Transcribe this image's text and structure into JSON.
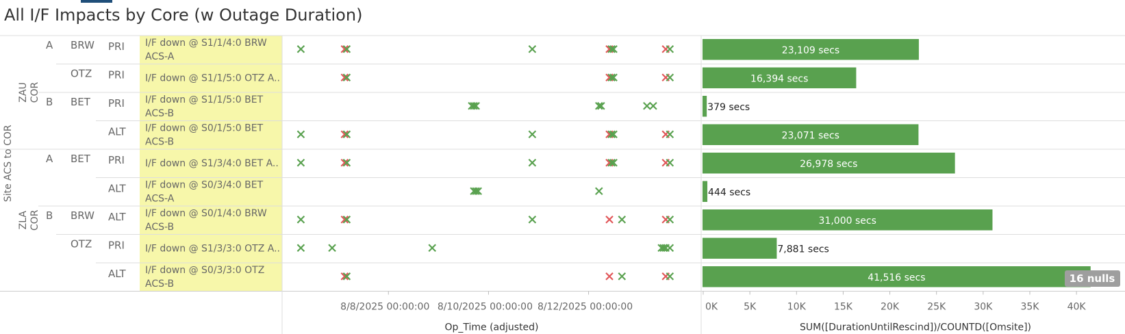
{
  "title": "All I/F Impacts by Core (w Outage Duration)",
  "chart_data": {
    "type": "bar",
    "title": "All I/F Impacts by Core (w Outage Duration)",
    "dimension_labels": {
      "outer": "Site ACS to COR"
    },
    "groups": [
      {
        "core": "ZAU COR",
        "row_start": 0,
        "row_end": 4
      },
      {
        "core": "ZLA COR",
        "row_start": 4,
        "row_end": 9
      }
    ],
    "rows": [
      {
        "core": "ZAU COR",
        "acs": "A",
        "site": "BRW",
        "path": "PRI",
        "interface": [
          "I/F down @ S1/1/4:0 BRW",
          "ACS-A"
        ],
        "value": 23109,
        "value_label": "23,109 secs",
        "marks": [
          {
            "x": "2025-08-06 06:00",
            "c": "g"
          },
          {
            "x": "2025-08-07 03:00",
            "c": "r"
          },
          {
            "x": "2025-08-07 04:00",
            "c": "g"
          },
          {
            "x": "2025-08-10 21:00",
            "c": "g"
          },
          {
            "x": "2025-08-12 10:00",
            "c": "r"
          },
          {
            "x": "2025-08-12 11:00",
            "c": "g"
          },
          {
            "x": "2025-08-12 12:00",
            "c": "g"
          },
          {
            "x": "2025-08-13 13:00",
            "c": "r"
          },
          {
            "x": "2025-08-13 15:00",
            "c": "g"
          }
        ]
      },
      {
        "core": "ZAU COR",
        "acs": "",
        "site": "OTZ",
        "path": "PRI",
        "interface": [
          "I/F down @ S1/1/5:0 OTZ A.."
        ],
        "value": 16394,
        "value_label": "16,394 secs",
        "marks": [
          {
            "x": "2025-08-07 03:00",
            "c": "r"
          },
          {
            "x": "2025-08-07 04:00",
            "c": "g"
          },
          {
            "x": "2025-08-12 10:00",
            "c": "r"
          },
          {
            "x": "2025-08-12 11:00",
            "c": "g"
          },
          {
            "x": "2025-08-12 12:00",
            "c": "g"
          },
          {
            "x": "2025-08-13 13:00",
            "c": "r"
          },
          {
            "x": "2025-08-13 15:00",
            "c": "g"
          }
        ]
      },
      {
        "core": "ZAU COR",
        "acs": "B",
        "site": "BET",
        "path": "PRI",
        "interface": [
          "I/F down @ S1/1/5:0 BET",
          "ACS-B"
        ],
        "value": 379,
        "value_label": "379 secs",
        "marks": [
          {
            "x": "2025-08-09 16:00",
            "c": "g"
          },
          {
            "x": "2025-08-09 17:00",
            "c": "g"
          },
          {
            "x": "2025-08-09 18:00",
            "c": "g"
          },
          {
            "x": "2025-08-12 05:00",
            "c": "g"
          },
          {
            "x": "2025-08-12 06:00",
            "c": "g"
          },
          {
            "x": "2025-08-13 04:00",
            "c": "g"
          },
          {
            "x": "2025-08-13 07:00",
            "c": "g"
          }
        ]
      },
      {
        "core": "ZAU COR",
        "acs": "",
        "site": "",
        "path": "ALT",
        "interface": [
          "I/F down @ S0/1/5:0 BET",
          "ACS-B"
        ],
        "value": 23071,
        "value_label": "23,071 secs",
        "marks": [
          {
            "x": "2025-08-06 06:00",
            "c": "g"
          },
          {
            "x": "2025-08-07 03:00",
            "c": "r"
          },
          {
            "x": "2025-08-07 04:00",
            "c": "g"
          },
          {
            "x": "2025-08-10 21:00",
            "c": "g"
          },
          {
            "x": "2025-08-12 10:00",
            "c": "r"
          },
          {
            "x": "2025-08-12 11:00",
            "c": "g"
          },
          {
            "x": "2025-08-12 12:00",
            "c": "g"
          },
          {
            "x": "2025-08-13 13:00",
            "c": "r"
          },
          {
            "x": "2025-08-13 15:00",
            "c": "g"
          }
        ]
      },
      {
        "core": "ZLA COR",
        "acs": "A",
        "site": "BET",
        "path": "PRI",
        "interface": [
          "I/F down @ S1/3/4:0 BET A.."
        ],
        "value": 26978,
        "value_label": "26,978 secs",
        "marks": [
          {
            "x": "2025-08-06 06:00",
            "c": "g"
          },
          {
            "x": "2025-08-07 03:00",
            "c": "r"
          },
          {
            "x": "2025-08-07 04:00",
            "c": "g"
          },
          {
            "x": "2025-08-10 21:00",
            "c": "g"
          },
          {
            "x": "2025-08-12 10:00",
            "c": "r"
          },
          {
            "x": "2025-08-12 11:00",
            "c": "g"
          },
          {
            "x": "2025-08-12 12:00",
            "c": "g"
          },
          {
            "x": "2025-08-13 13:00",
            "c": "r"
          },
          {
            "x": "2025-08-13 15:00",
            "c": "g"
          }
        ]
      },
      {
        "core": "ZLA COR",
        "acs": "",
        "site": "",
        "path": "ALT",
        "interface": [
          "I/F down @ S0/3/4:0 BET",
          "ACS-A"
        ],
        "value": 444,
        "value_label": "444 secs",
        "marks": [
          {
            "x": "2025-08-09 17:00",
            "c": "g"
          },
          {
            "x": "2025-08-09 18:00",
            "c": "g"
          },
          {
            "x": "2025-08-09 19:00",
            "c": "g"
          },
          {
            "x": "2025-08-12 05:00",
            "c": "g"
          }
        ]
      },
      {
        "core": "ZLA COR",
        "acs": "B",
        "site": "BRW",
        "path": "ALT",
        "interface": [
          "I/F down @ S0/1/4:0 BRW",
          "ACS-B"
        ],
        "value": 31000,
        "value_label": "31,000 secs",
        "marks": [
          {
            "x": "2025-08-06 06:00",
            "c": "g"
          },
          {
            "x": "2025-08-07 03:00",
            "c": "r"
          },
          {
            "x": "2025-08-07 04:00",
            "c": "g"
          },
          {
            "x": "2025-08-10 21:00",
            "c": "g"
          },
          {
            "x": "2025-08-12 10:00",
            "c": "r"
          },
          {
            "x": "2025-08-12 16:00",
            "c": "g"
          },
          {
            "x": "2025-08-13 13:00",
            "c": "r"
          },
          {
            "x": "2025-08-13 15:00",
            "c": "g"
          }
        ]
      },
      {
        "core": "ZLA COR",
        "acs": "",
        "site": "OTZ",
        "path": "PRI",
        "interface": [
          "I/F down @ S1/3/3:0 OTZ A.."
        ],
        "value": 7881,
        "value_label": "7,881 secs",
        "marks": [
          {
            "x": "2025-08-06 06:00",
            "c": "g"
          },
          {
            "x": "2025-08-06 21:00",
            "c": "g"
          },
          {
            "x": "2025-08-08 21:00",
            "c": "g"
          },
          {
            "x": "2025-08-13 11:00",
            "c": "g"
          },
          {
            "x": "2025-08-13 12:00",
            "c": "g"
          },
          {
            "x": "2025-08-13 13:00",
            "c": "g"
          },
          {
            "x": "2025-08-13 15:00",
            "c": "g"
          }
        ]
      },
      {
        "core": "ZLA COR",
        "acs": "",
        "site": "",
        "path": "ALT",
        "interface": [
          "I/F down @ S0/3/3:0 OTZ",
          "ACS-B"
        ],
        "value": 41516,
        "value_label": "41,516 secs",
        "marks": [
          {
            "x": "2025-08-07 03:00",
            "c": "r"
          },
          {
            "x": "2025-08-07 04:00",
            "c": "g"
          },
          {
            "x": "2025-08-12 10:00",
            "c": "r"
          },
          {
            "x": "2025-08-12 16:00",
            "c": "g"
          },
          {
            "x": "2025-08-13 13:00",
            "c": "r"
          },
          {
            "x": "2025-08-13 15:00",
            "c": "g"
          }
        ]
      }
    ],
    "scatter_axis": {
      "title": "Op_Time (adjusted)",
      "range": [
        "2025-08-05 21:00",
        "2025-08-14 06:00"
      ],
      "ticks": [
        "8/8/2025 00:00:00",
        "8/10/2025 00:00:00",
        "8/12/2025 00:00:00"
      ]
    },
    "bar_axis": {
      "title": "SUM([DurationUntilRescind])/COUNTD([Omsite])",
      "range": [
        0,
        43000
      ],
      "ticks": [
        0,
        5000,
        10000,
        15000,
        20000,
        25000,
        30000,
        35000,
        40000
      ],
      "tick_labels": [
        "0K",
        "5K",
        "10K",
        "15K",
        "20K",
        "25K",
        "30K",
        "35K",
        "40K"
      ]
    },
    "nulls_badge": "16 nulls",
    "colors": {
      "green_mark": "#59a14f",
      "red_mark": "#e15759",
      "bar": "#59a14f",
      "highlight": "#f7f7aa",
      "badge": "#9e9e9e"
    }
  }
}
